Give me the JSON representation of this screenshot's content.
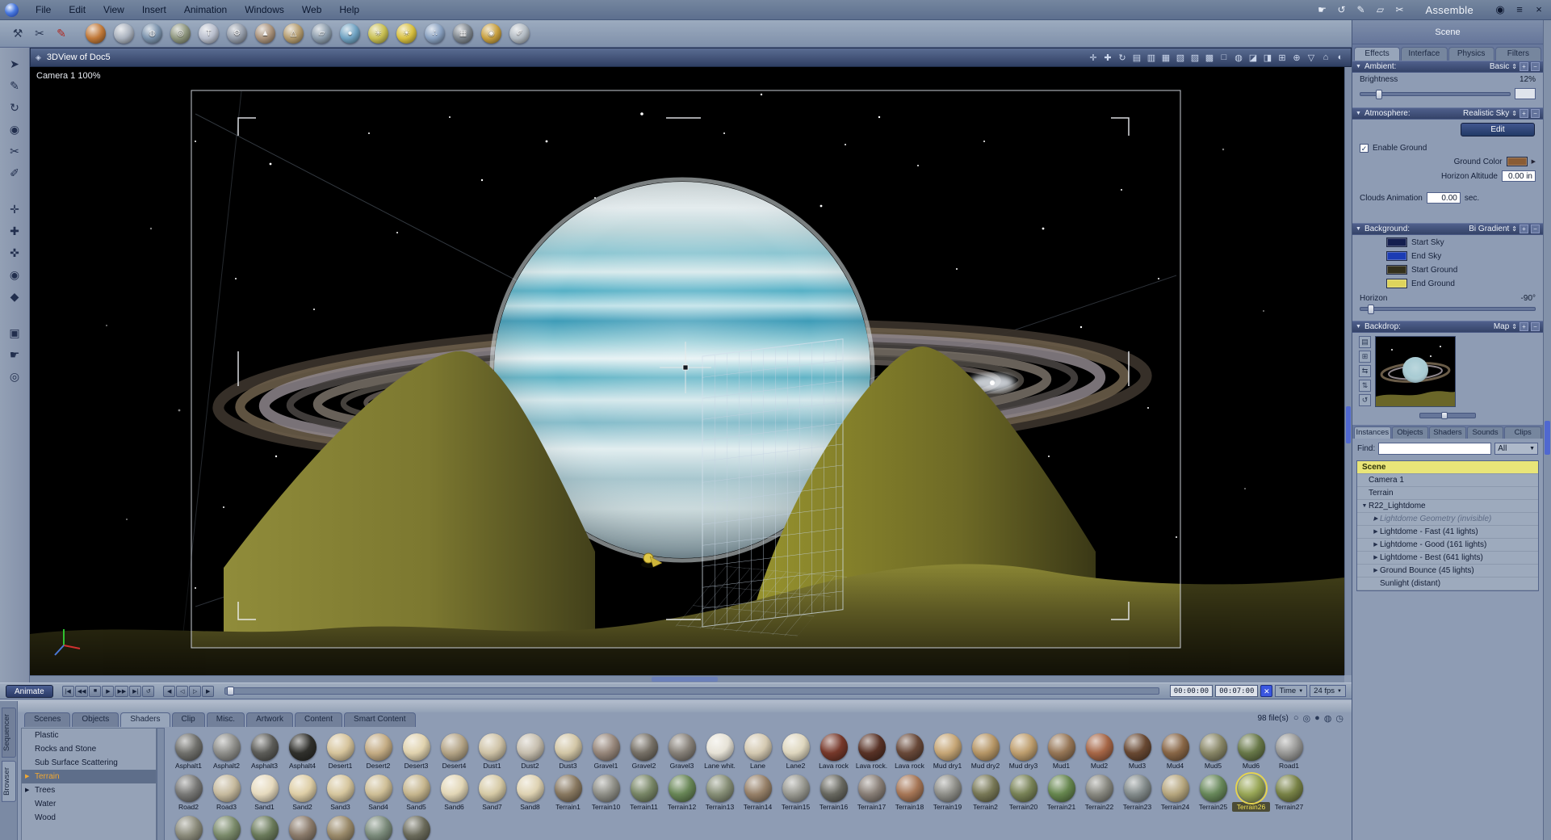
{
  "app": {
    "room_label": "Assemble"
  },
  "menubar": {
    "items": [
      {
        "name": "menu-file",
        "label": "File"
      },
      {
        "name": "menu-edit",
        "label": "Edit"
      },
      {
        "name": "menu-view",
        "label": "View"
      },
      {
        "name": "menu-insert",
        "label": "Insert"
      },
      {
        "name": "menu-animation",
        "label": "Animation"
      },
      {
        "name": "menu-windows",
        "label": "Windows"
      },
      {
        "name": "menu-web",
        "label": "Web"
      },
      {
        "name": "menu-help",
        "label": "Help"
      }
    ],
    "right_icons": [
      {
        "name": "quick-hand-icon",
        "glyph": "☛"
      },
      {
        "name": "quick-rotate-icon",
        "glyph": "↺"
      },
      {
        "name": "quick-pencil-icon",
        "glyph": "✎"
      },
      {
        "name": "quick-plane-icon",
        "glyph": "▱"
      },
      {
        "name": "quick-knife-icon",
        "glyph": "✂"
      }
    ],
    "window_icons": [
      {
        "name": "eye-icon",
        "glyph": "◉"
      },
      {
        "name": "window-menu-icon",
        "glyph": "≡"
      },
      {
        "name": "close-icon",
        "glyph": "×"
      }
    ]
  },
  "toolbar": {
    "left_tools": [
      {
        "name": "wrench-icon",
        "glyph": "⚒"
      },
      {
        "name": "cutter-icon",
        "glyph": "✂"
      },
      {
        "name": "paintbrush-icon",
        "glyph": "✎",
        "red": true
      }
    ],
    "primitives": [
      {
        "name": "sphere-tool-icon",
        "color": "#c07838",
        "glyph": ""
      },
      {
        "name": "vertical-modeler-tool-icon",
        "color": "#aab2be",
        "glyph": ""
      },
      {
        "name": "mesh-sphere-tool-icon",
        "color": "#7a92ac",
        "glyph": "◍"
      },
      {
        "name": "ring-tool-icon",
        "color": "#8e967e",
        "glyph": "◎"
      },
      {
        "name": "text-tool-icon",
        "color": "#b8becc",
        "glyph": "T"
      },
      {
        "name": "gear-tool-icon",
        "color": "#939ba8",
        "glyph": "⚙"
      },
      {
        "name": "pyramid-tool-icon",
        "color": "#a8917a",
        "glyph": "▲"
      },
      {
        "name": "cone-tool-icon",
        "color": "#b39b6e",
        "glyph": "△"
      },
      {
        "name": "plane-tool-icon",
        "color": "#8c9cac",
        "glyph": "▱"
      },
      {
        "name": "liquid-drop-tool-icon",
        "color": "#6fa2c2",
        "glyph": "●"
      },
      {
        "name": "spiky-particle-tool-icon",
        "color": "#c8bf52",
        "glyph": "✳"
      },
      {
        "name": "sun-light-tool-icon",
        "color": "#d8c040",
        "glyph": "☀"
      },
      {
        "name": "particles-tool-icon",
        "color": "#88a0c0",
        "glyph": "∴"
      },
      {
        "name": "train-tool-icon",
        "color": "#7c848c",
        "glyph": "▦"
      },
      {
        "name": "coin-tool-icon",
        "color": "#c8a040",
        "glyph": "◉"
      },
      {
        "name": "needle-tool-icon",
        "color": "#b2bac2",
        "glyph": "✐"
      }
    ]
  },
  "toolcol": {
    "tools": [
      {
        "name": "select-tool-icon",
        "glyph": "➤"
      },
      {
        "name": "draw-tool-icon",
        "glyph": "✎"
      },
      {
        "name": "rotate-tool-icon",
        "glyph": "↻"
      },
      {
        "name": "sphere-of-attraction-icon",
        "glyph": "◉"
      },
      {
        "name": "knife-tool-icon",
        "glyph": "✂"
      },
      {
        "name": "eyedropper-tool-icon",
        "glyph": "✐"
      },
      {
        "name": "move-xy-tool-icon",
        "glyph": "✛",
        "gap": true
      },
      {
        "name": "move-xz-tool-icon",
        "glyph": "✚"
      },
      {
        "name": "move-yz-tool-icon",
        "glyph": "✜"
      },
      {
        "name": "hotpoint-tool-icon",
        "glyph": "◉",
        "gold": true
      },
      {
        "name": "paint-bucket-tool-icon",
        "glyph": "◆"
      },
      {
        "name": "render-area-tool-icon",
        "glyph": "▣",
        "gap": true
      },
      {
        "name": "pan-hand-tool-icon",
        "glyph": "☛"
      },
      {
        "name": "zoom-tool-icon",
        "glyph": "◎"
      }
    ]
  },
  "viewport": {
    "title": "3DView of Doc5",
    "camera_label": "Camera 1 100%",
    "titlebar_icons": [
      {
        "name": "camera-track-icon",
        "glyph": "✛"
      },
      {
        "name": "camera-pan-icon",
        "glyph": "✚"
      },
      {
        "name": "camera-bank-icon",
        "glyph": "↻"
      },
      {
        "name": "wireframe-mode-icon",
        "glyph": "▤"
      },
      {
        "name": "lit-wireframe-mode-icon",
        "glyph": "▥"
      },
      {
        "name": "flat-shading-mode-icon",
        "glyph": "▦"
      },
      {
        "name": "gouraud-mode-icon",
        "glyph": "▧"
      },
      {
        "name": "phong-mode-icon",
        "glyph": "▨"
      },
      {
        "name": "textured-mode-icon",
        "glyph": "▩"
      },
      {
        "name": "bounding-box-mode-icon",
        "glyph": "□"
      },
      {
        "name": "preview-quality-icon",
        "glyph": "◍"
      },
      {
        "name": "shadows-toggle-icon",
        "glyph": "◪"
      },
      {
        "name": "backdrop-toggle-icon",
        "glyph": "◨"
      },
      {
        "name": "production-frame-icon",
        "glyph": "⊞"
      },
      {
        "name": "camera-reset-icon",
        "glyph": "⊕"
      },
      {
        "name": "display-options-icon",
        "glyph": "▽"
      },
      {
        "name": "home-view-icon",
        "glyph": "⌂"
      },
      {
        "name": "render-preview-icon",
        "glyph": "◐"
      }
    ]
  },
  "right_panel": {
    "title": "Scene",
    "tabs": [
      {
        "label": "Effects",
        "active": true
      },
      {
        "label": "Interface"
      },
      {
        "label": "Physics"
      },
      {
        "label": "Filters"
      }
    ],
    "ambient": {
      "label": "Ambient:",
      "mode": "Basic",
      "brightness_label": "Brightness",
      "brightness_value": "12%"
    },
    "atmosphere": {
      "label": "Atmosphere:",
      "mode": "Realistic Sky",
      "edit_label": "Edit",
      "enable_ground_label": "Enable Ground",
      "check_glyph": "✓",
      "ground_color_label": "Ground Color",
      "ground_color": "#8a5c34",
      "horizon_altitude_label": "Horizon Altitude",
      "horizon_altitude_value": "0.00 in",
      "clouds_label": "Clouds Animation",
      "clouds_value": "0.00",
      "clouds_unit": "sec."
    },
    "background": {
      "label": "Background:",
      "mode": "Bi Gradient",
      "swatches": [
        {
          "label": "Start Sky",
          "color": "#141e4e"
        },
        {
          "label": "End Sky",
          "color": "#1c3cb4"
        },
        {
          "label": "Start Ground",
          "color": "#33301c"
        },
        {
          "label": "End Ground",
          "color": "#ded45c"
        }
      ],
      "horizon_label": "Horizon",
      "horizon_value": "-90°"
    },
    "backdrop": {
      "label": "Backdrop:",
      "mode": "Map",
      "icons": [
        {
          "name": "backdrop-image-icon",
          "glyph": "▤"
        },
        {
          "name": "backdrop-fit-icon",
          "glyph": "⊞"
        },
        {
          "name": "backdrop-swap-icon",
          "glyph": "⇆"
        },
        {
          "name": "backdrop-move-icon",
          "glyph": "⇅"
        },
        {
          "name": "backdrop-reset-icon",
          "glyph": "↺"
        }
      ]
    },
    "list_tabs": [
      {
        "label": "Instances",
        "active": true
      },
      {
        "label": "Objects"
      },
      {
        "label": "Shaders"
      },
      {
        "label": "Sounds"
      },
      {
        "label": "Clips"
      }
    ],
    "find_label": "Find:",
    "filter_value": "All",
    "scene_tree": {
      "root": "Scene",
      "items": [
        {
          "label": "Camera 1",
          "indent": 0,
          "tri": ""
        },
        {
          "label": "Terrain",
          "indent": 0,
          "tri": ""
        },
        {
          "label": "R22_Lightdome",
          "indent": 0,
          "tri": "▼"
        },
        {
          "label": "Lightdome Geometry (invisible)",
          "indent": 1,
          "tri": "▶",
          "dim": true
        },
        {
          "label": "Lightdome - Fast (41 lights)",
          "indent": 1,
          "tri": "▶"
        },
        {
          "label": "Lightdome - Good (161 lights)",
          "indent": 1,
          "tri": "▶"
        },
        {
          "label": "Lightdome - Best (641 lights)",
          "indent": 1,
          "tri": "▶"
        },
        {
          "label": "Ground Bounce (45 lights)",
          "indent": 1,
          "tri": "▶"
        },
        {
          "label": "Sunlight (distant)",
          "indent": 1,
          "tri": ""
        }
      ]
    }
  },
  "timeline": {
    "animate_label": "Animate",
    "transport1": [
      {
        "name": "go-start-button",
        "glyph": "|◀"
      },
      {
        "name": "frame-back-button",
        "glyph": "◀◀"
      },
      {
        "name": "stop-button",
        "glyph": "■"
      },
      {
        "name": "play-button",
        "glyph": "▶"
      },
      {
        "name": "frame-forward-button",
        "glyph": "▶▶"
      },
      {
        "name": "go-end-button",
        "glyph": "▶|"
      },
      {
        "name": "loop-button",
        "glyph": "↺"
      }
    ],
    "transport2": [
      {
        "name": "prev-key-button",
        "glyph": "◀"
      },
      {
        "name": "delete-key-button",
        "glyph": "◁"
      },
      {
        "name": "add-key-button",
        "glyph": "▷"
      },
      {
        "name": "next-key-button",
        "glyph": "▶"
      }
    ],
    "current_time": "00:00:00",
    "end_time": "00:07:00",
    "close_glyph": "✕",
    "time_label": "Time",
    "fps_label": "24 fps"
  },
  "browser": {
    "side_tabs": [
      {
        "label": "Sequencer"
      },
      {
        "label": "Browser",
        "active": true
      }
    ],
    "tabs": [
      {
        "label": "Scenes"
      },
      {
        "label": "Objects"
      },
      {
        "label": "Shaders",
        "active": true
      },
      {
        "label": "Clip"
      },
      {
        "label": "Misc."
      },
      {
        "label": "Artwork"
      },
      {
        "label": "Content"
      },
      {
        "label": "Smart Content"
      }
    ],
    "file_count": "98 file(s)",
    "right_icons": [
      {
        "name": "thumb-size-small-icon",
        "glyph": "○"
      },
      {
        "name": "thumb-size-medium-icon",
        "glyph": "◎"
      },
      {
        "name": "thumb-size-large-icon",
        "glyph": "●"
      },
      {
        "name": "preview-sphere-icon",
        "glyph": "◍"
      },
      {
        "name": "recent-files-icon",
        "glyph": "◷"
      }
    ],
    "categories": [
      {
        "label": "Plastic",
        "tri": ""
      },
      {
        "label": "Rocks and Stone",
        "tri": ""
      },
      {
        "label": "Sub Surface Scattering",
        "tri": ""
      },
      {
        "label": "Terrain",
        "tri": "▶",
        "active": true
      },
      {
        "label": "Trees",
        "tri": "▶"
      },
      {
        "label": "Water",
        "tri": ""
      },
      {
        "label": "Wood",
        "tri": ""
      }
    ],
    "thumbnails_row1": [
      {
        "label": "Asphalt1",
        "color": "#70706c"
      },
      {
        "label": "Asphalt2",
        "color": "#8e8e8a"
      },
      {
        "label": "Asphalt3",
        "color": "#5c5c58"
      },
      {
        "label": "Asphalt4",
        "color": "#30302c"
      },
      {
        "label": "Desert1",
        "color": "#d6c49c"
      },
      {
        "label": "Desert2",
        "color": "#c4ac84"
      },
      {
        "label": "Desert3",
        "color": "#e0d2ae"
      },
      {
        "label": "Desert4",
        "color": "#b4a486"
      },
      {
        "label": "Dust1",
        "color": "#cec2a6"
      },
      {
        "label": "Dust2",
        "color": "#c6beae"
      },
      {
        "label": "Dust3",
        "color": "#d2c6a6"
      },
      {
        "label": "Gravel1",
        "color": "#96867a"
      },
      {
        "label": "Gravel2",
        "color": "#767066"
      },
      {
        "label": "Gravel3",
        "color": "#868078"
      },
      {
        "label": "Lane whit.",
        "color": "#e6e2d6"
      },
      {
        "label": "Lane",
        "color": "#d4c9b1"
      },
      {
        "label": "Lane2",
        "color": "#ded6be"
      },
      {
        "label": "Lava rock",
        "color": "#76382a"
      },
      {
        "label": "Lava rock.",
        "color": "#583226"
      },
      {
        "label": "Lava rock",
        "color": "#684838"
      },
      {
        "label": "Mud dry1",
        "color": "#c6a676"
      },
      {
        "label": "Mud dry2",
        "color": "#b69666"
      },
      {
        "label": "Mud dry3",
        "color": "#be9e6e"
      },
      {
        "label": "Mud1",
        "color": "#967656"
      },
      {
        "label": "Mud2",
        "color": "#a66646"
      },
      {
        "label": "Mud3",
        "color": "#684832"
      },
      {
        "label": "Mud4",
        "color": "#886646"
      },
      {
        "label": "Mud5",
        "color": "#888666"
      },
      {
        "label": "Mud6",
        "color": "#687848"
      },
      {
        "label": "Road1",
        "color": "#989896"
      }
    ],
    "thumbnails_row2": [
      {
        "label": "Road2",
        "color": "#787876"
      },
      {
        "label": "Road3",
        "color": "#c6ba9e"
      },
      {
        "label": "Sand1",
        "color": "#e6dabe"
      },
      {
        "label": "Sand2",
        "color": "#decea6"
      },
      {
        "label": "Sand3",
        "color": "#d6c69e"
      },
      {
        "label": "Sand4",
        "color": "#cebe96"
      },
      {
        "label": "Sand5",
        "color": "#c6b68e"
      },
      {
        "label": "Sand6",
        "color": "#e2d6b6"
      },
      {
        "label": "Sand7",
        "color": "#d6caa6"
      },
      {
        "label": "Sand8",
        "color": "#ded2b2"
      },
      {
        "label": "Terrain1",
        "color": "#887860"
      },
      {
        "label": "Terrain10",
        "color": "#8e8e86"
      },
      {
        "label": "Terrain11",
        "color": "#788666"
      },
      {
        "label": "Terrain12",
        "color": "#688656"
      },
      {
        "label": "Terrain13",
        "color": "#868e76"
      },
      {
        "label": "Terrain14",
        "color": "#968068"
      },
      {
        "label": "Terrain15",
        "color": "#989890"
      },
      {
        "label": "Terrain16",
        "color": "#686860"
      },
      {
        "label": "Terrain17",
        "color": "#887e76"
      },
      {
        "label": "Terrain18",
        "color": "#a67656"
      },
      {
        "label": "Terrain19",
        "color": "#8e8e88"
      },
      {
        "label": "Terrain2",
        "color": "#787856"
      },
      {
        "label": "Terrain20",
        "color": "#788256"
      },
      {
        "label": "Terrain21",
        "color": "#66864e"
      },
      {
        "label": "Terrain22",
        "color": "#888880"
      },
      {
        "label": "Terrain23",
        "color": "#828a8a"
      },
      {
        "label": "Terrain24",
        "color": "#b6a67e"
      },
      {
        "label": "Terrain25",
        "color": "#68885a"
      },
      {
        "label": "Terrain26",
        "color": "#98a656",
        "selected": true
      },
      {
        "label": "Terrain27",
        "color": "#788246"
      }
    ],
    "thumbnails_row3": [
      {
        "color": "#8a8a7a"
      },
      {
        "color": "#7a8a6a"
      },
      {
        "color": "#6a7a5a"
      },
      {
        "color": "#8a7a6a"
      },
      {
        "color": "#9a8a6a"
      },
      {
        "color": "#7a8a7a"
      },
      {
        "color": "#6a6a5a"
      }
    ]
  }
}
